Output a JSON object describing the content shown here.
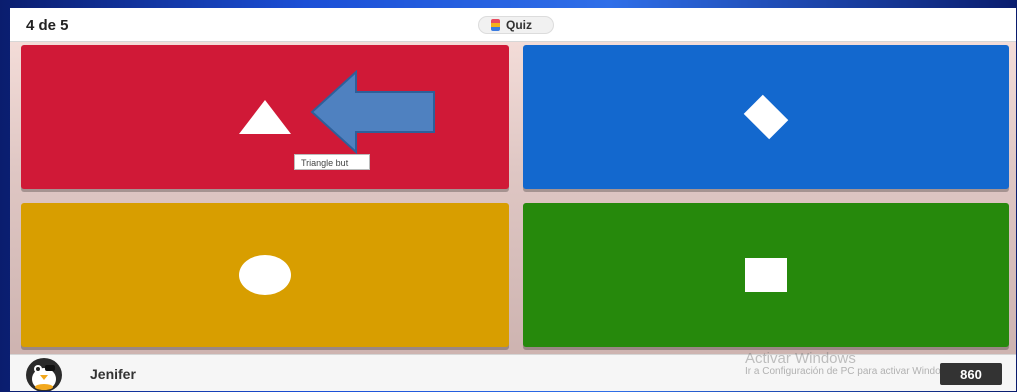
{
  "header": {
    "question_counter": "4 de 5",
    "mode_label": "Quiz",
    "mode_icon": "quiz-icon"
  },
  "answers": [
    {
      "shape": "triangle-icon",
      "color": "#d01937"
    },
    {
      "shape": "diamond-icon",
      "color": "#1368ce"
    },
    {
      "shape": "circle-icon",
      "color": "#d89e00"
    },
    {
      "shape": "square-icon",
      "color": "#26890c"
    }
  ],
  "tooltip": {
    "text": "Triangle but"
  },
  "footer": {
    "player_name": "Jenifer",
    "score": "860",
    "watermark_title": "Activar Windows",
    "watermark_subtitle": "Ir a Configuración de PC para activar Windows."
  }
}
